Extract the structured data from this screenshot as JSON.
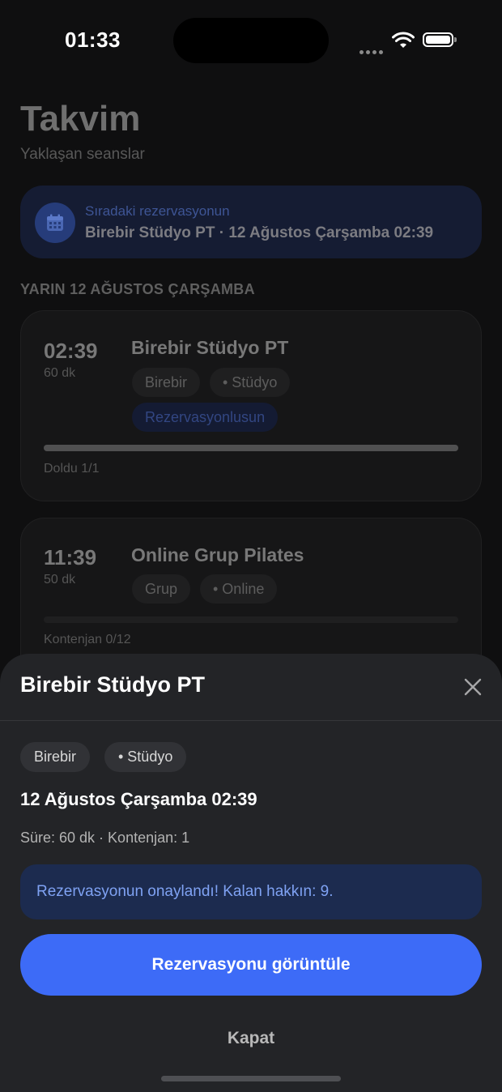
{
  "status_bar": {
    "time": "01:33"
  },
  "header": {
    "title": "Takvim",
    "subtitle": "Yaklaşan seanslar"
  },
  "next_booking": {
    "label": "Sıradaki rezervasyonun",
    "value": "Birebir Stüdyo PT · 12 Ağustos Çarşamba 02:39",
    "icon": "calendar-icon"
  },
  "day_header": "YARIN 12 AĞUSTOS ÇARŞAMBA",
  "sessions": [
    {
      "time": "02:39",
      "duration": "60 dk",
      "title": "Birebir Stüdyo PT",
      "tags": [
        "Birebir",
        "• Stüdyo"
      ],
      "status": "Rezervasyonlusun",
      "capacity": "Doldu 1/1",
      "fill": 1.0
    },
    {
      "time": "11:39",
      "duration": "50 dk",
      "title": "Online Grup Pilates",
      "tags": [
        "Grup",
        "• Online"
      ],
      "capacity": "Kontenjan 0/12",
      "fill": 0.0
    }
  ],
  "sheet": {
    "title": "Birebir Stüdyo PT",
    "tags": [
      "Birebir",
      "• Stüdyo"
    ],
    "datetime": "12 Ağustos Çarşamba 02:39",
    "meta": "Süre: 60 dk · Kontenjan: 1",
    "notice": "Rezervasyonun onaylandı! Kalan hakkın: 9.",
    "primary_button": "Rezervasyonu görüntüle",
    "secondary_button": "Kapat"
  },
  "colors": {
    "accent": "#3d6bf7",
    "notice_bg": "#1c2b4f",
    "notice_text": "#7fa2f3",
    "sheet_bg": "#232427"
  }
}
